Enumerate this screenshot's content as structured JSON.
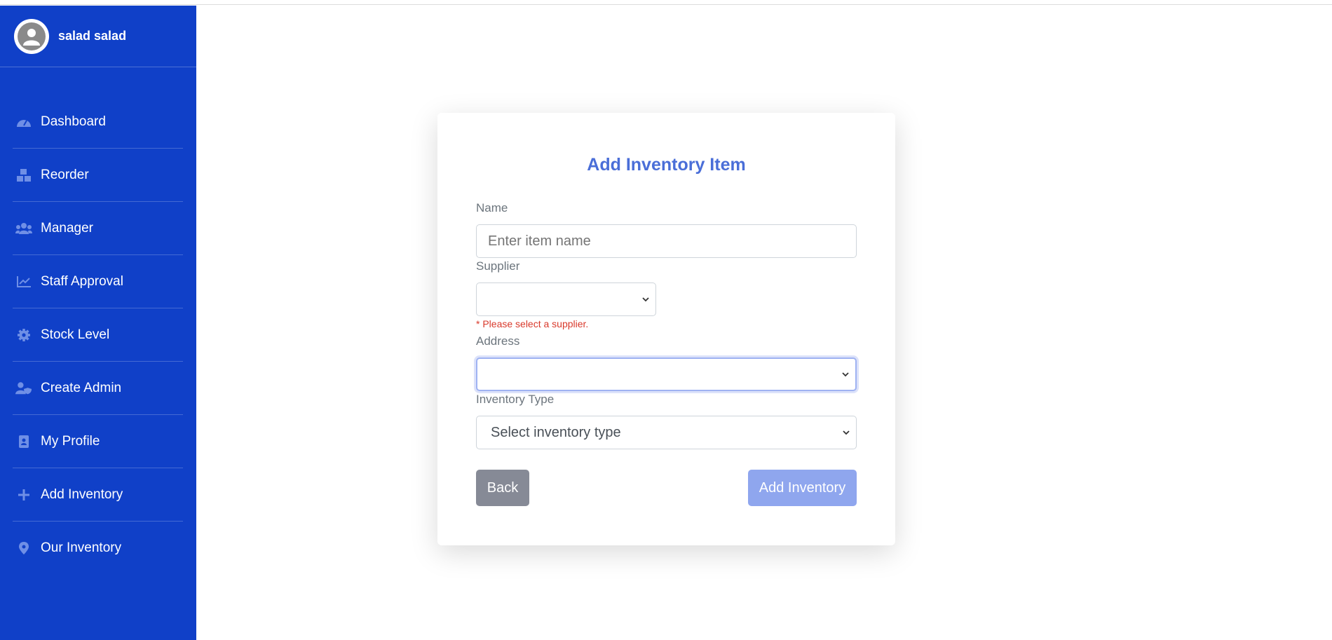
{
  "user": {
    "name": "salad salad"
  },
  "sidebar": {
    "items": [
      {
        "label": "Dashboard",
        "icon": "dashboard-icon"
      },
      {
        "label": "Reorder",
        "icon": "boxes-icon"
      },
      {
        "label": "Manager",
        "icon": "users-icon"
      },
      {
        "label": "Staff Approval",
        "icon": "chart-line-icon"
      },
      {
        "label": "Stock Level",
        "icon": "gear-icon"
      },
      {
        "label": "Create Admin",
        "icon": "user-shield-icon"
      },
      {
        "label": "My Profile",
        "icon": "id-badge-icon"
      },
      {
        "label": "Add Inventory",
        "icon": "plus-icon"
      },
      {
        "label": "Our Inventory",
        "icon": "map-pin-icon"
      }
    ]
  },
  "form": {
    "title": "Add Inventory Item",
    "name_label": "Name",
    "name_placeholder": "Enter item name",
    "supplier_label": "Supplier",
    "supplier_value": "",
    "supplier_error": "* Please select a supplier.",
    "address_label": "Address",
    "address_value": "",
    "type_label": "Inventory Type",
    "type_value": "Select inventory type",
    "back_label": "Back",
    "submit_label": "Add Inventory"
  },
  "colors": {
    "sidebar": "#1040c8",
    "title": "#4a6ed8",
    "error": "#d9392b",
    "back_button": "#868a96",
    "submit_button": "#8fa6ee"
  }
}
